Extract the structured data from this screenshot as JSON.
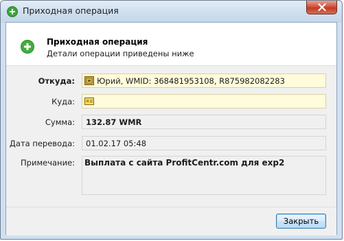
{
  "window": {
    "title": "Приходная операция",
    "close_icon": "close-icon"
  },
  "header": {
    "title": "Приходная операция",
    "subtitle": "Детали операции приведены ниже",
    "icon": "add-circle-icon"
  },
  "form": {
    "from_label": "Откуда:",
    "from_value": "Юрий, WMID: 368481953108, R875982082283",
    "to_label": "Куда:",
    "to_value": "",
    "amount_label": "Сумма:",
    "amount_value": "132.87 WMR",
    "date_label": "Дата перевода:",
    "date_value": "01.02.17 05:48",
    "note_label": "Примечание:",
    "note_value": "Выплата с сайта ProfitCentr.com для exp2"
  },
  "footer": {
    "close_button": "Закрыть"
  },
  "colors": {
    "accent": "#3c7fb1",
    "highlight_field": "#fffbdb",
    "plus_green": "#3aa63a"
  }
}
